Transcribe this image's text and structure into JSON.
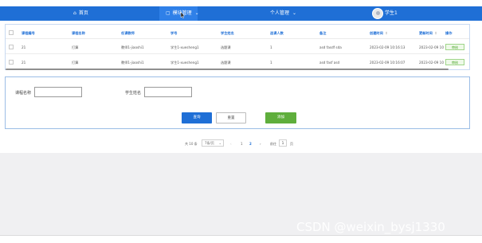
{
  "nav": {
    "home": "首页",
    "module": "模块管理",
    "personal": "个人管理",
    "user": "学生1",
    "chevron": "⌄"
  },
  "table": {
    "headers": [
      "课程编号",
      "课程名称",
      "任课教师",
      "学号",
      "学生姓名",
      "选课人数",
      "备注",
      "创建时间",
      "更新时间",
      "操作"
    ],
    "header_sort_marks": [
      "↕",
      "↕"
    ],
    "rows": [
      [
        "21",
        "打算",
        "教师1-jiaoshi1",
        "学生1-xuesheng1",
        "选题课",
        "1",
        "asd fasdf sda",
        "2023-02-09 10:16:13",
        "2023-02-09 10",
        "审核"
      ],
      [
        "21",
        "打算",
        "教师1-jiaoshi1",
        "学生1-xuesheng1",
        "选题课",
        "1",
        "asd fasf asd",
        "2023-02-09 10:16:07",
        "2023-02-09 10",
        "审核"
      ]
    ]
  },
  "search": {
    "course_label": "课程名称",
    "student_label": "学生姓名",
    "query_btn": "查询",
    "reset_btn": "重置",
    "add_btn": "添加"
  },
  "pagination": {
    "total": "共 10 条",
    "per_page": "7条/页",
    "pages": [
      "1",
      "2"
    ],
    "prev": "‹",
    "next": "›",
    "goto_label": "前往",
    "goto_value": "1",
    "page_suffix": "页"
  },
  "watermark": "CSDN @weixin_bysj1330",
  "colors": {
    "nav": "#1f6fd6",
    "primary": "#1f6fd6",
    "success": "#5fae3c"
  }
}
